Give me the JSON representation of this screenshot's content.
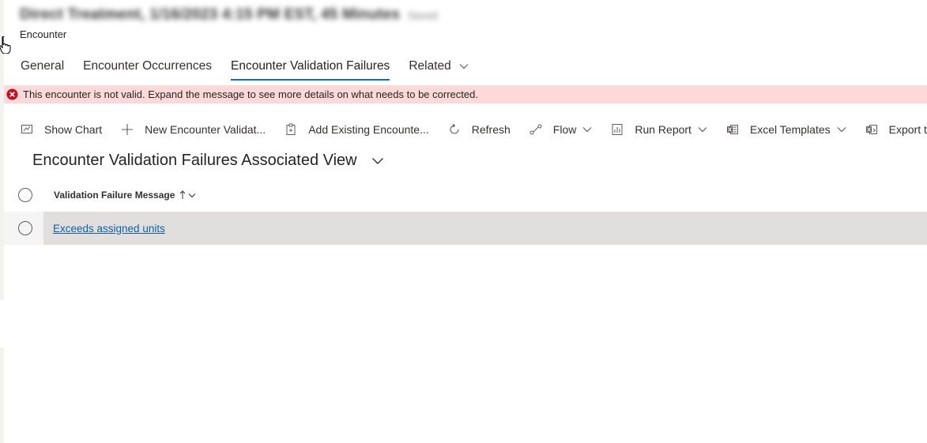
{
  "header": {
    "blurred_title": "Direct Treatment, 1/16/2023 4:15 PM EST, 45 Minutes",
    "blurred_status": "Saved",
    "entity_label": "Encounter"
  },
  "tabs": [
    {
      "label": "General"
    },
    {
      "label": "Encounter Occurrences"
    },
    {
      "label": "Encounter Validation Failures",
      "active": true
    },
    {
      "label": "Related"
    }
  ],
  "error": {
    "message": "This encounter is not valid. Expand the message to see more details on what needs to be corrected.",
    "icon": "error-circle-icon",
    "color": "#c50f1f"
  },
  "commands": [
    {
      "label": "Show Chart",
      "icon": "chart-icon"
    },
    {
      "label": "New Encounter Validat...",
      "icon": "plus-icon"
    },
    {
      "label": "Add Existing Encounte...",
      "icon": "add-existing-icon"
    },
    {
      "label": "Refresh",
      "icon": "refresh-icon"
    },
    {
      "label": "Flow",
      "icon": "flow-icon"
    },
    {
      "label": "Run Report",
      "icon": "report-icon"
    },
    {
      "label": "Excel Templates",
      "icon": "excel-icon"
    },
    {
      "label": "Export t",
      "icon": "export-excel-icon"
    }
  ],
  "view": {
    "title": "Encounter Validation Failures Associated View"
  },
  "grid": {
    "column": "Validation Failure Message",
    "rows": [
      {
        "message": "Exceeds assigned units"
      }
    ]
  },
  "colors": {
    "accent": "#0f6cbd",
    "error_bg": "#fed9d9",
    "link": "#115ea3",
    "row_selected": "#e1dfdd"
  }
}
